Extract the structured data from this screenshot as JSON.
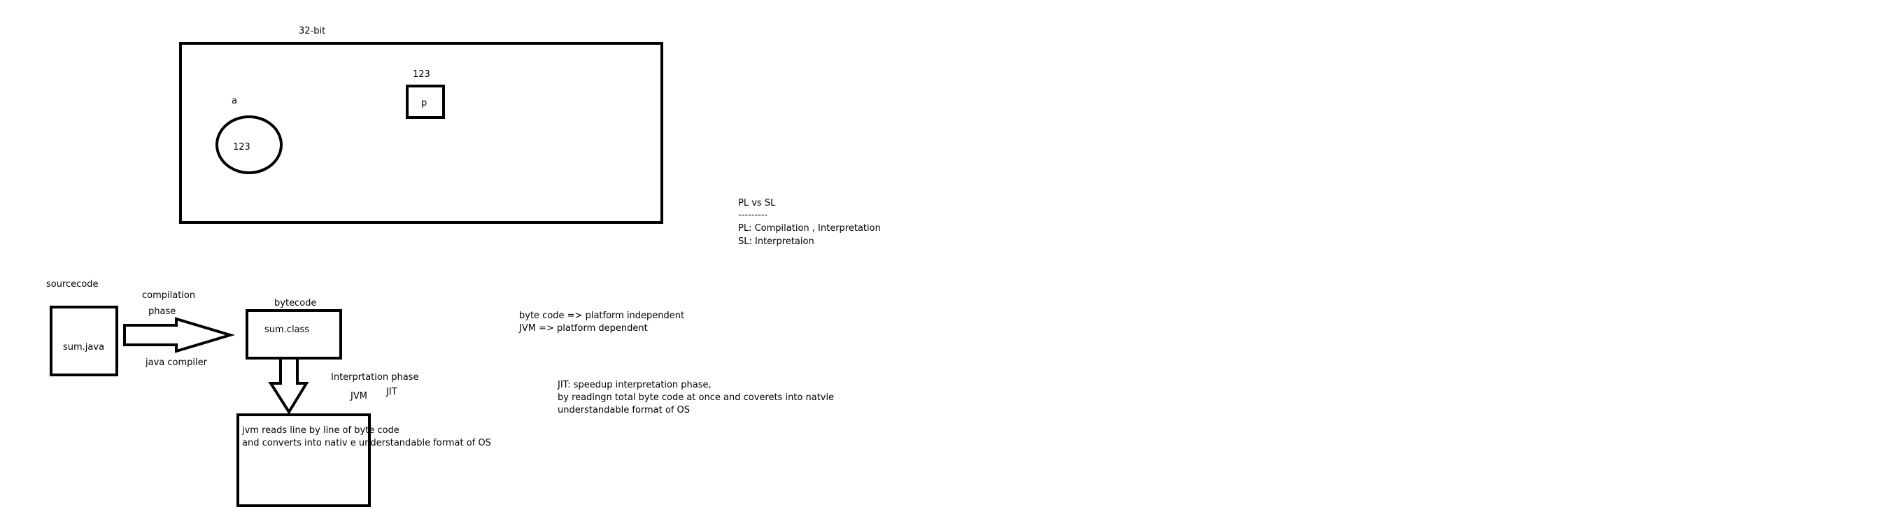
{
  "memory": {
    "title": "32-bit",
    "var_a_label": "a",
    "var_a_value": "123",
    "p_value_label": "123",
    "p_box_label": "p"
  },
  "pl_sl": {
    "line1": "PL vs SL",
    "line2": "---------",
    "line3": "PL: Compilation , Interpretation",
    "line4": "SL: Interpretaion"
  },
  "flow": {
    "sourcecode_label": "sourcecode",
    "sum_java": "sum.java",
    "compilation_label": "compilation",
    "phase_label": "phase",
    "java_compiler_label": "java compiler",
    "bytecode_label": "bytecode",
    "sum_class": "sum.class",
    "interp_phase_label": "Interprtation phase",
    "jvm_label": "JVM",
    "jit_label": "JIT",
    "jvm_box_line1": "jvm reads line by line of byte code",
    "jvm_box_line2": "and converts into nativ e understandable format of OS"
  },
  "bytecode_notes": {
    "line1": "byte code => platform independent",
    "line2": "JVM => platform dependent"
  },
  "jit_notes": {
    "line1": "JIT: speedup interpretation phase,",
    "line2": "by readingn total byte code at once and coverets into natvie",
    "line3": "understandable format of OS"
  }
}
